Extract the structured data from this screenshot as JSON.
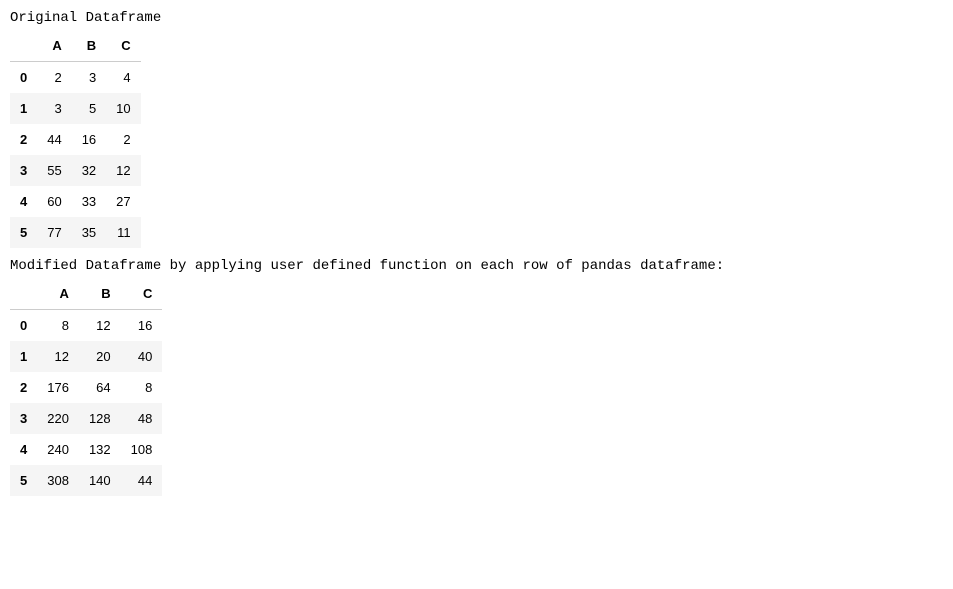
{
  "label1": "Original Dataframe",
  "label2": "Modified Dataframe by applying user defined function on each row of pandas dataframe:",
  "table1": {
    "columns": [
      "A",
      "B",
      "C"
    ],
    "index": [
      "0",
      "1",
      "2",
      "3",
      "4",
      "5"
    ],
    "data": [
      [
        "2",
        "3",
        "4"
      ],
      [
        "3",
        "5",
        "10"
      ],
      [
        "44",
        "16",
        "2"
      ],
      [
        "55",
        "32",
        "12"
      ],
      [
        "60",
        "33",
        "27"
      ],
      [
        "77",
        "35",
        "11"
      ]
    ]
  },
  "table2": {
    "columns": [
      "A",
      "B",
      "C"
    ],
    "index": [
      "0",
      "1",
      "2",
      "3",
      "4",
      "5"
    ],
    "data": [
      [
        "8",
        "12",
        "16"
      ],
      [
        "12",
        "20",
        "40"
      ],
      [
        "176",
        "64",
        "8"
      ],
      [
        "220",
        "128",
        "48"
      ],
      [
        "240",
        "132",
        "108"
      ],
      [
        "308",
        "140",
        "44"
      ]
    ]
  }
}
